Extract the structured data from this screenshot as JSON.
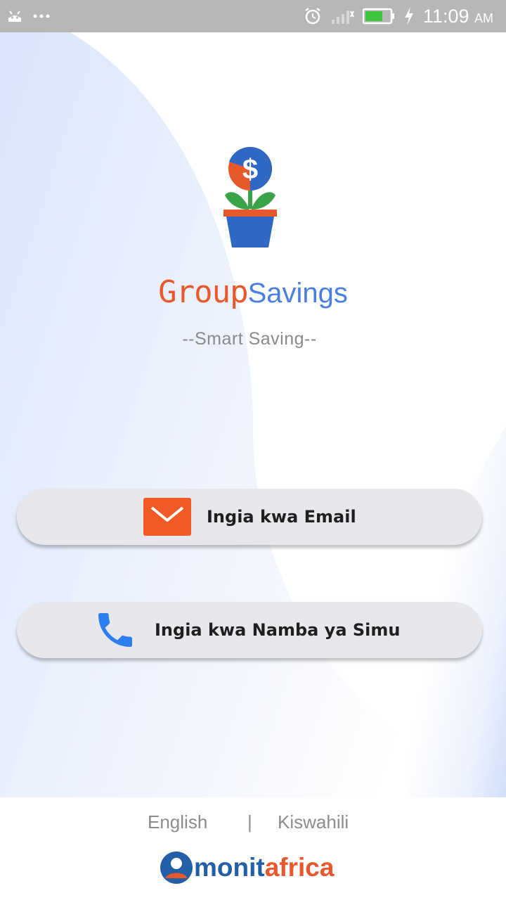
{
  "status_bar": {
    "time": "11:09",
    "ampm": "AM"
  },
  "app": {
    "brand_part1": "Group",
    "brand_part2": "Savings",
    "tagline": "--Smart Saving--",
    "logo_icon": "money-plant-icon",
    "colors": {
      "orange": "#e8582d",
      "blue": "#4a7fe0",
      "green": "#3aa34a"
    }
  },
  "login": {
    "email_label": "Ingia kwa Email",
    "email_icon": "envelope-icon",
    "phone_label": "Ingia kwa Namba ya Simu",
    "phone_icon": "phone-icon"
  },
  "footer": {
    "lang_english": "English",
    "separator": "|",
    "lang_kiswahili": "Kiswahili",
    "brand_mon": "monit",
    "brand_afr": "africa"
  }
}
